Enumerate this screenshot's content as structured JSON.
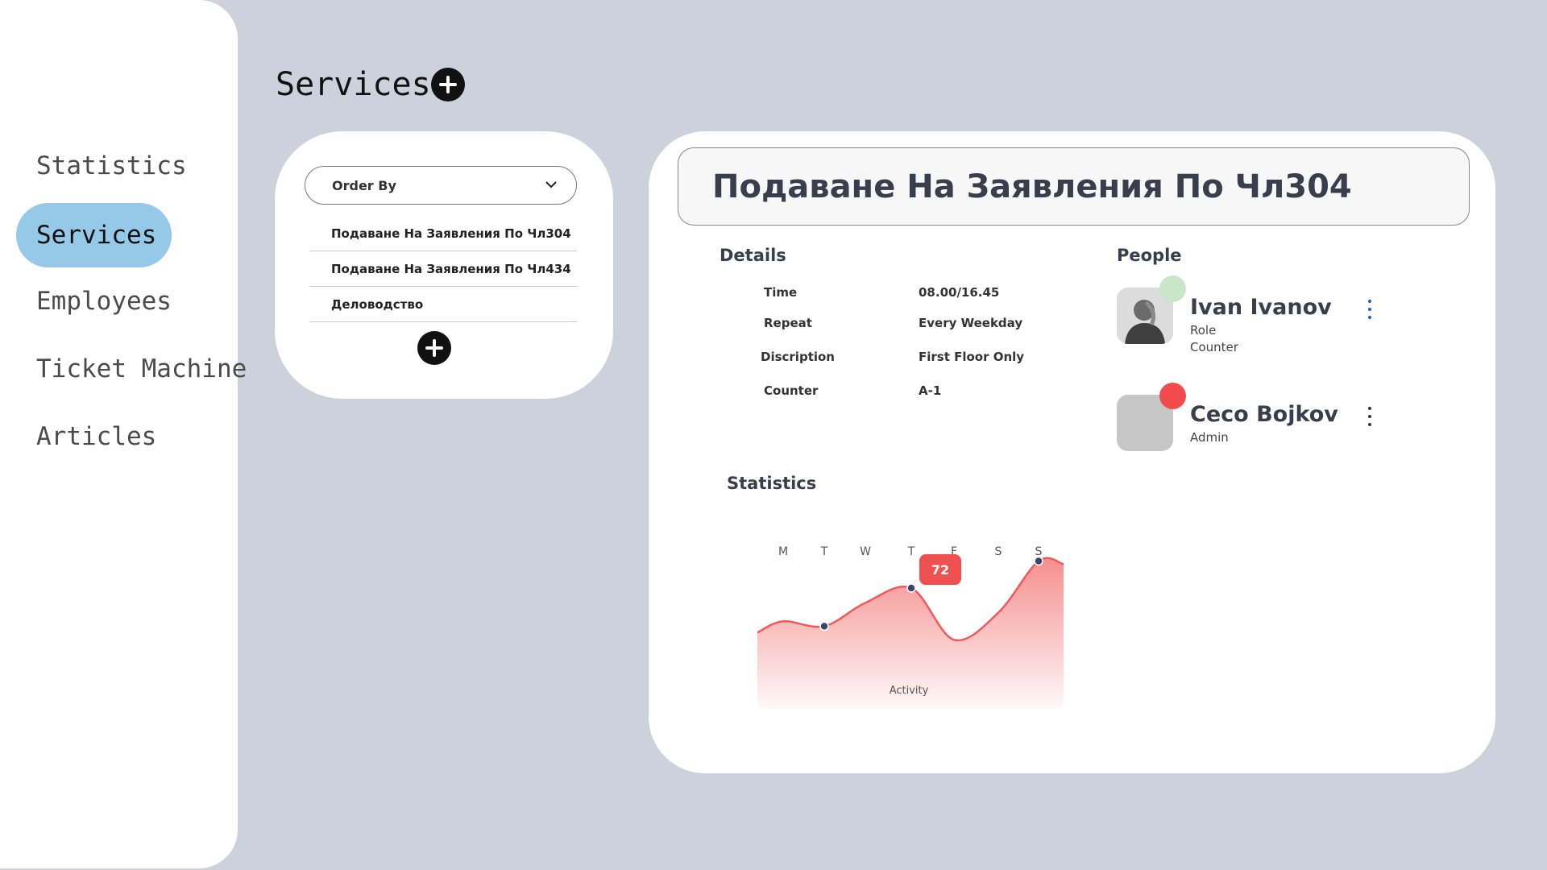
{
  "sidebar": {
    "items": [
      {
        "label": "Statistics",
        "active": false
      },
      {
        "label": "Services",
        "active": true
      },
      {
        "label": "Employees",
        "active": false
      },
      {
        "label": "Ticket Machine",
        "active": false
      },
      {
        "label": "Articles",
        "active": false
      }
    ]
  },
  "header": {
    "title": "Services",
    "add_icon": "plus-circle-icon"
  },
  "services_panel": {
    "order_by_label": "Order By",
    "items": [
      "Подаване На Заявления По Чл304",
      "Подаване На Заявления По Чл434",
      "Деловодство"
    ],
    "add_icon": "plus-circle-icon"
  },
  "detail": {
    "title": "Подаване На Заявления По Чл304",
    "details": {
      "heading": "Details",
      "rows": [
        {
          "label": "Time",
          "value": "08.00/16.45"
        },
        {
          "label": "Repeat",
          "value": "Every Weekday"
        },
        {
          "label": "Discription",
          "value": "First Floor Only"
        },
        {
          "label": "Counter",
          "value": "A-1"
        }
      ]
    },
    "people": {
      "heading": "People",
      "list": [
        {
          "name": "Ivan Ivanov",
          "sub1": "Role",
          "sub2": "Counter",
          "status_color": "#c9e6c8",
          "kebab_color": "#1d5fd1"
        },
        {
          "name": "Ceco Bojkov",
          "sub1": "Admin",
          "sub2": "",
          "status_color": "#f24b4b",
          "kebab_color": "#333333"
        }
      ]
    },
    "statistics": {
      "heading": "Statistics"
    }
  },
  "chart_data": {
    "type": "area",
    "categories": [
      "M",
      "T",
      "W",
      "T",
      "F",
      "S",
      "S"
    ],
    "values": [
      45,
      41,
      60,
      72,
      30,
      52,
      94
    ],
    "highlight": {
      "category_index": 3,
      "label": "72"
    },
    "xlabel": "Activity",
    "colors": {
      "fill": "#f47a7a",
      "line": "#ef5a5a",
      "badge": "#ef5050",
      "point": "#3d4466"
    }
  },
  "colors": {
    "background": "#cdd1dc",
    "accent": "#96c8e8",
    "card": "#ffffff"
  }
}
